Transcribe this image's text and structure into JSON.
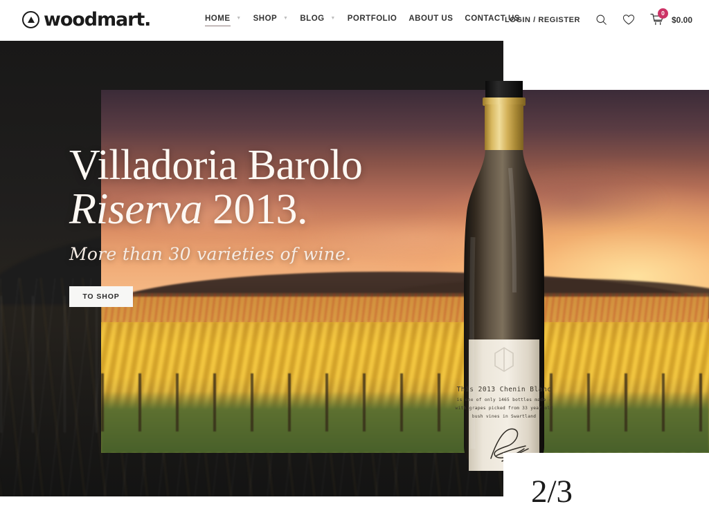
{
  "header": {
    "logo": {
      "text": "woodmart.",
      "icon": "circle-triangle-logo-icon"
    },
    "nav": [
      {
        "label": "HOME",
        "active": true,
        "has_caret": true
      },
      {
        "label": "SHOP",
        "active": false,
        "has_caret": true
      },
      {
        "label": "BLOG",
        "active": false,
        "has_caret": true
      },
      {
        "label": "PORTFOLIO",
        "active": false,
        "has_caret": false
      },
      {
        "label": "ABOUT US",
        "active": false,
        "has_caret": false
      },
      {
        "label": "CONTACT US",
        "active": false,
        "has_caret": false
      }
    ],
    "tools": {
      "login_label": "LOGIN / REGISTER",
      "search_icon": "search-icon",
      "wishlist_icon": "heart-icon",
      "cart_icon": "shopping-cart-icon",
      "cart_count": "0",
      "cart_total": "$0.00",
      "cart_badge_color": "#cc3366"
    }
  },
  "hero": {
    "headline_line1": "Villadoria Barolo",
    "headline_italic": "Riserva",
    "headline_year": "2013.",
    "subheadline": "More than 30 varieties of wine.",
    "cta_label": "TO SHOP",
    "slide_counter": "2/3",
    "bottle": {
      "alt": "white wine bottle with gold foil capsule",
      "label_line1": "This 2013 Chenin Blanc",
      "label_line2": "is one of only 1465 bottles made -",
      "label_line3": "with grapes picked from 33 year old",
      "label_line4": "bush vines in Swartland"
    },
    "colors": {
      "backdrop": "#2a2a2a",
      "sky_top": "#3b2b38",
      "sky_bottom": "#f7c08c",
      "vines": "#eab62f",
      "grass": "#4d6a2c",
      "cta_bg": "#f7f7f5",
      "text": "#fdf8f3"
    }
  }
}
